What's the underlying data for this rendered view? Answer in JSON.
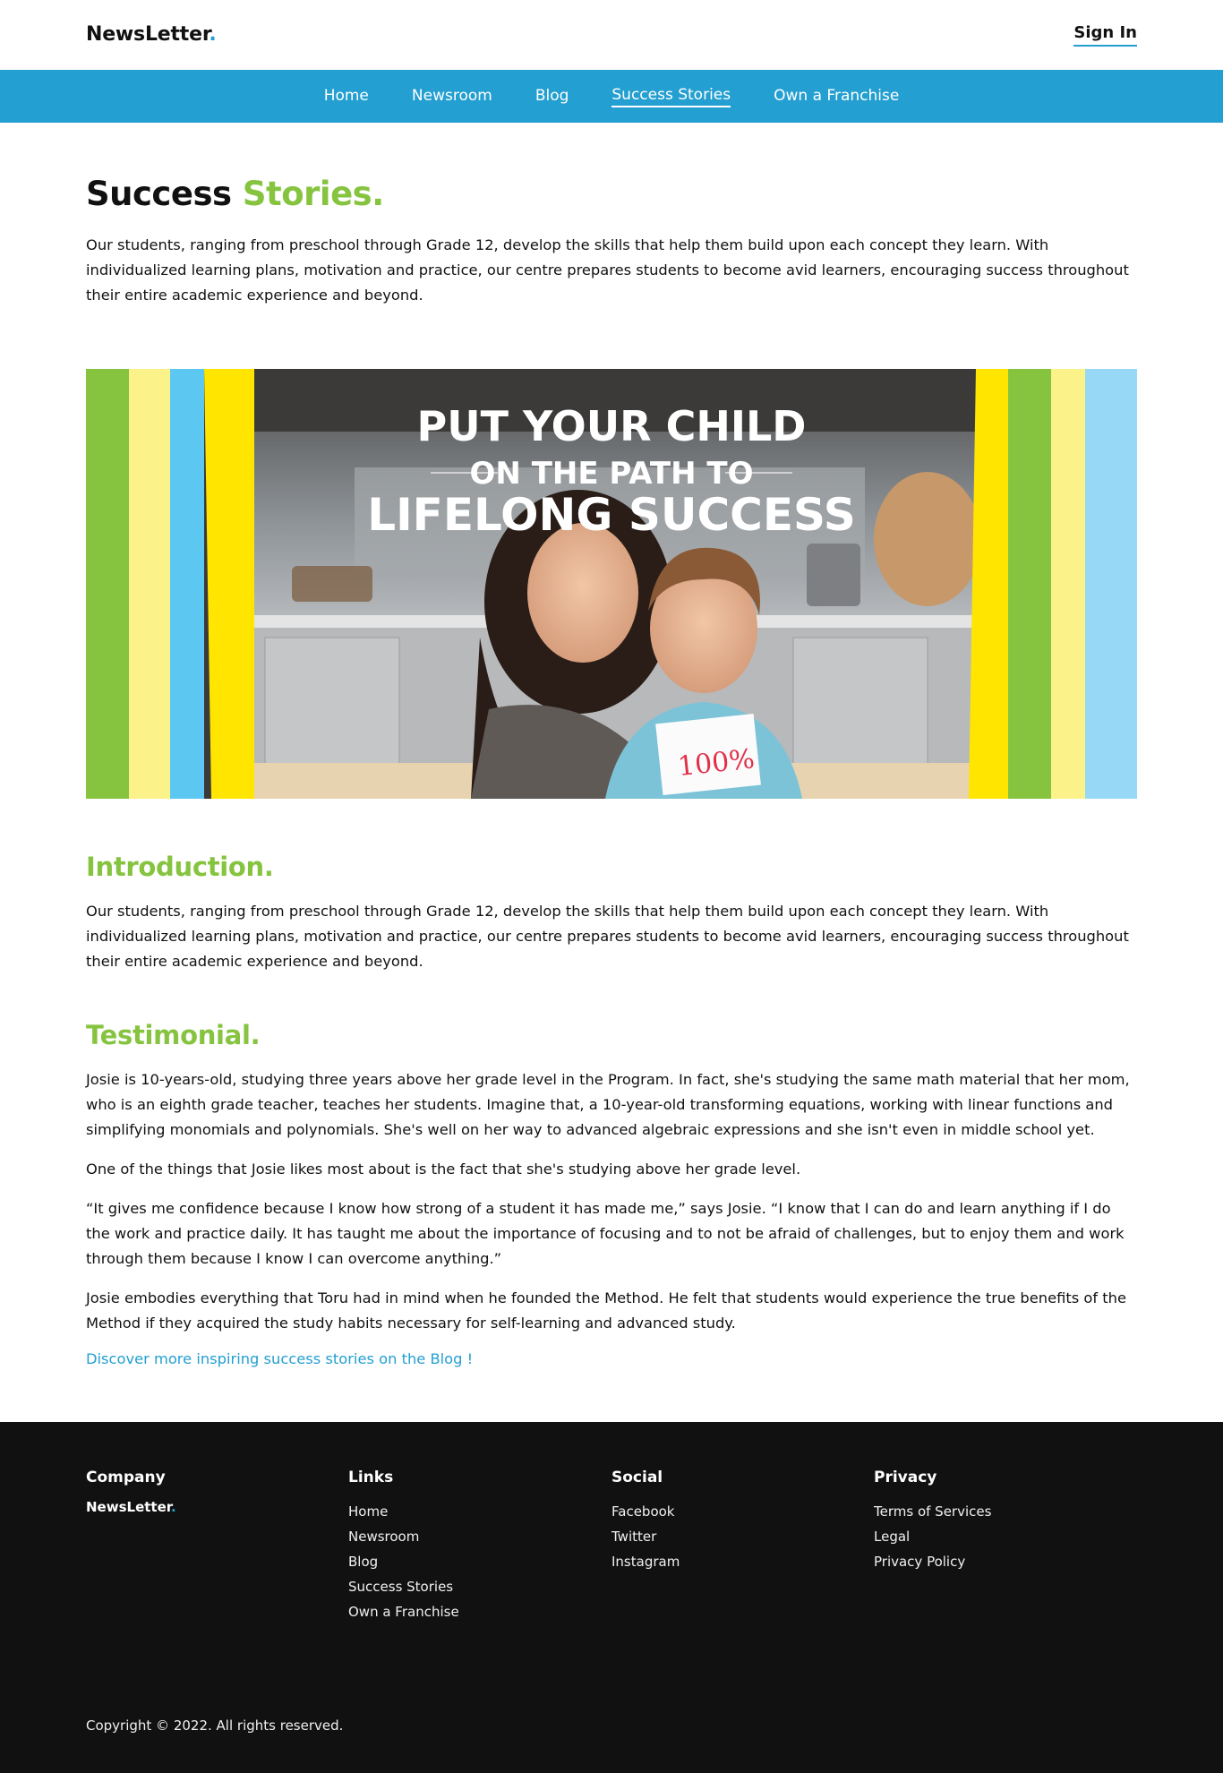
{
  "header": {
    "logo_text": "NewsLetter",
    "logo_dot": ".",
    "signin_label": "Sign In"
  },
  "nav": {
    "items": [
      {
        "label": "Home"
      },
      {
        "label": "Newsroom"
      },
      {
        "label": "Blog"
      },
      {
        "label": "Success Stories",
        "active": true
      },
      {
        "label": "Own a Franchise"
      }
    ]
  },
  "page": {
    "title_main": "Success",
    "title_accent": "Stories.",
    "lead": "Our students, ranging from preschool through Grade 12, develop the skills that help them build upon each concept they learn. With individualized learning plans, motivation and practice, our centre prepares students to become avid learners, encouraging success throughout their entire academic experience and beyond."
  },
  "hero": {
    "line1": "PUT YOUR CHILD",
    "line2": "ON THE PATH TO",
    "line3": "LIFELONG SUCCESS",
    "paper_text": "100%"
  },
  "intro": {
    "heading": "Introduction.",
    "body": "Our students, ranging from preschool through Grade 12, develop the skills that help them build upon each concept they learn. With individualized learning plans, motivation and practice, our centre prepares students to become avid learners, encouraging success throughout their entire academic experience and beyond."
  },
  "testimonial": {
    "heading": "Testimonial.",
    "p1": "Josie is 10-years-old, studying three years above her grade level in the Program. In fact, she's studying the same math material that her mom, who is an eighth grade teacher, teaches her students. Imagine that, a 10-year-old transforming equations, working with linear functions and simplifying monomials and polynomials. She's well on her way to advanced algebraic expressions and she isn't even in middle school yet.",
    "p2": "One of the things that Josie likes most about is the fact that she's studying above her grade level.",
    "p3": "“It gives me confidence because I know how strong of a student it has made me,” says Josie. “I know that I can do and learn anything if I do the work and practice daily. It has taught me about the importance of focusing and to not be afraid of challenges, but to enjoy them and work through them because I know I can overcome anything.”",
    "p4": "Josie embodies everything that Toru had in mind when he founded the Method. He felt that students would experience the true benefits of the Method if they acquired the study habits necessary for self-learning and advanced study.",
    "link": "Discover more inspiring success stories on the Blog !"
  },
  "footer": {
    "company": {
      "heading": "Company",
      "logo_text": "NewsLetter",
      "logo_dot": "."
    },
    "links": {
      "heading": "Links",
      "items": [
        "Home",
        "Newsroom",
        "Blog",
        "Success Stories",
        "Own a Franchise"
      ]
    },
    "social": {
      "heading": "Social",
      "items": [
        "Facebook",
        "Twitter",
        "Instagram"
      ]
    },
    "privacy": {
      "heading": "Privacy",
      "items": [
        "Terms of Services",
        "Legal",
        "Privacy Policy"
      ]
    },
    "copyright": "Copyright © 2022. All rights reserved."
  },
  "colors": {
    "accent_blue": "#249fd1",
    "accent_green": "#86c440",
    "footer_bg": "#111111"
  }
}
